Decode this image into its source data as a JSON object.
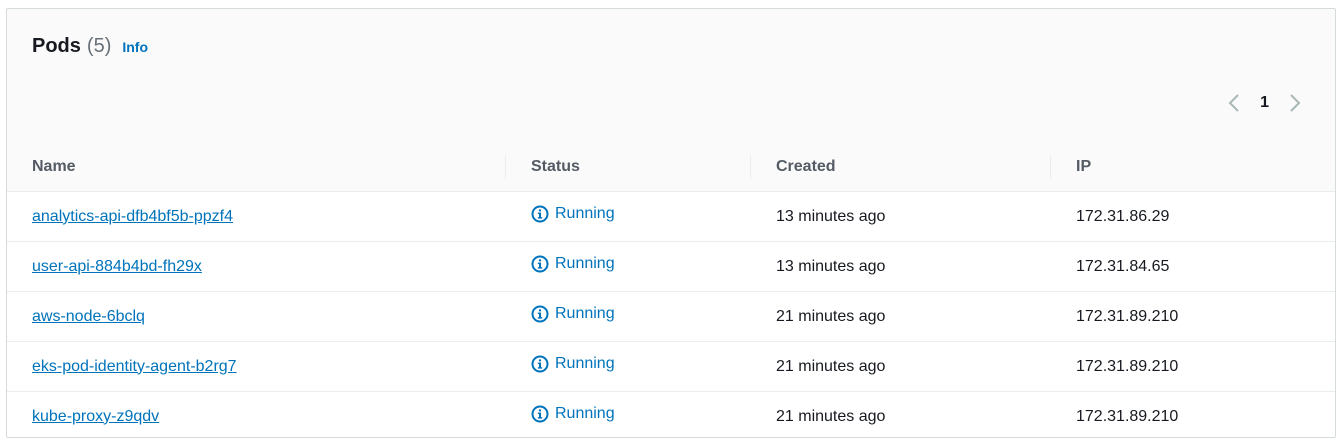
{
  "header": {
    "title": "Pods",
    "count": "(5)",
    "info_label": "Info"
  },
  "pagination": {
    "current_page": "1",
    "prev_icon": "chevron-left-icon",
    "next_icon": "chevron-right-icon"
  },
  "table": {
    "columns": [
      "Name",
      "Status",
      "Created",
      "IP"
    ],
    "rows": [
      {
        "name": "analytics-api-dfb4bf5b-ppzf4",
        "status": "Running",
        "created": "13 minutes ago",
        "ip": "172.31.86.29"
      },
      {
        "name": "user-api-884b4bd-fh29x",
        "status": "Running",
        "created": "13 minutes ago",
        "ip": "172.31.84.65"
      },
      {
        "name": "aws-node-6bclq",
        "status": "Running",
        "created": "21 minutes ago",
        "ip": "172.31.89.210"
      },
      {
        "name": "eks-pod-identity-agent-b2rg7",
        "status": "Running",
        "created": "21 minutes ago",
        "ip": "172.31.89.210"
      },
      {
        "name": "kube-proxy-z9qdv",
        "status": "Running",
        "created": "21 minutes ago",
        "ip": "172.31.89.210"
      }
    ]
  },
  "colors": {
    "link": "#0073bb",
    "status_info": "#0073bb",
    "header_bg": "#fafafa"
  }
}
